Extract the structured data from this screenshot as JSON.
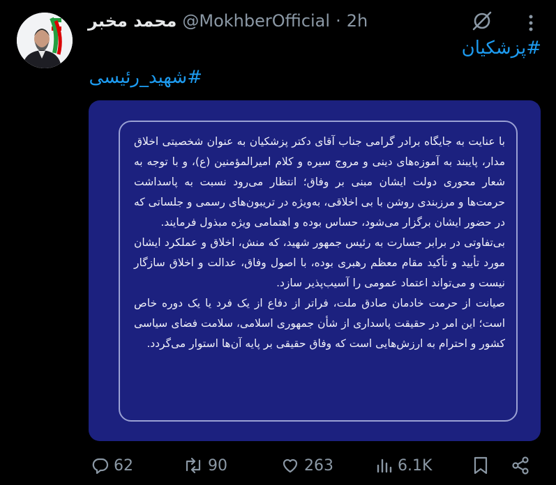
{
  "author": {
    "display_name": "محمد مخبر",
    "handle": "@MokhberOfficial",
    "separator": "·",
    "time": "2h"
  },
  "hashtags": {
    "first": "#پزشکیان",
    "second": "#شهید_رئیسی"
  },
  "statement": {
    "p1": "با عنایت به جایگاه برادر گرامی جناب آقای دکتر پزشکیان به عنوان شخصیتی اخلاق مدار، پایبند به آموزه‌های دینی و مروج سیره و کلام امیرالمؤمنین (ع)، و با توجه به شعار محوری دولت ایشان مبنی بر وفاق؛ انتظار می‌رود نسبت به پاسداشت حرمت‌ها و مرزبندی روشن با بی اخلاقی، به‌ویژه در تریبون‌های رسمی و جلساتی که در حضور ایشان برگزار می‌شود، حساس بوده و اهتمامی ویژه مبذول فرمایند.",
    "p2": "بی‌تفاوتی در برابر جسارت به رئیس جمهور شهید، که منش، اخلاق و عملکرد ایشان مورد تأیید و تأکید مقام معظم رهبری بوده، با اصول وفاق، عدالت و اخلاق سازگار نیست و می‌تواند اعتماد عمومی را آسیب‌پذیر سازد.",
    "p3": "صیانت از حرمت خادمان صادق ملت، فراتر از دفاع از یک فرد یا یک دوره خاص است؛ این امر در حقیقت پاسداری از شأن جمهوری اسلامی، سلامت فضای سیاسی کشور و احترام به ارزش‌هایی است که وفاق حقیقی بر پایه آن‌ها استوار می‌گردد."
  },
  "metrics": {
    "replies": "62",
    "reposts": "90",
    "likes": "263",
    "views": "6.1K"
  },
  "icons": {
    "grok": "grok-icon",
    "more": "more-icon",
    "reply": "reply-icon",
    "repost": "repost-icon",
    "like": "heart-icon",
    "views": "views-icon",
    "bookmark": "bookmark-icon",
    "share": "share-icon"
  },
  "colors": {
    "background": "#000000",
    "link": "#1d9bf0",
    "muted": "#8b98a5",
    "card": "#1c217f"
  }
}
